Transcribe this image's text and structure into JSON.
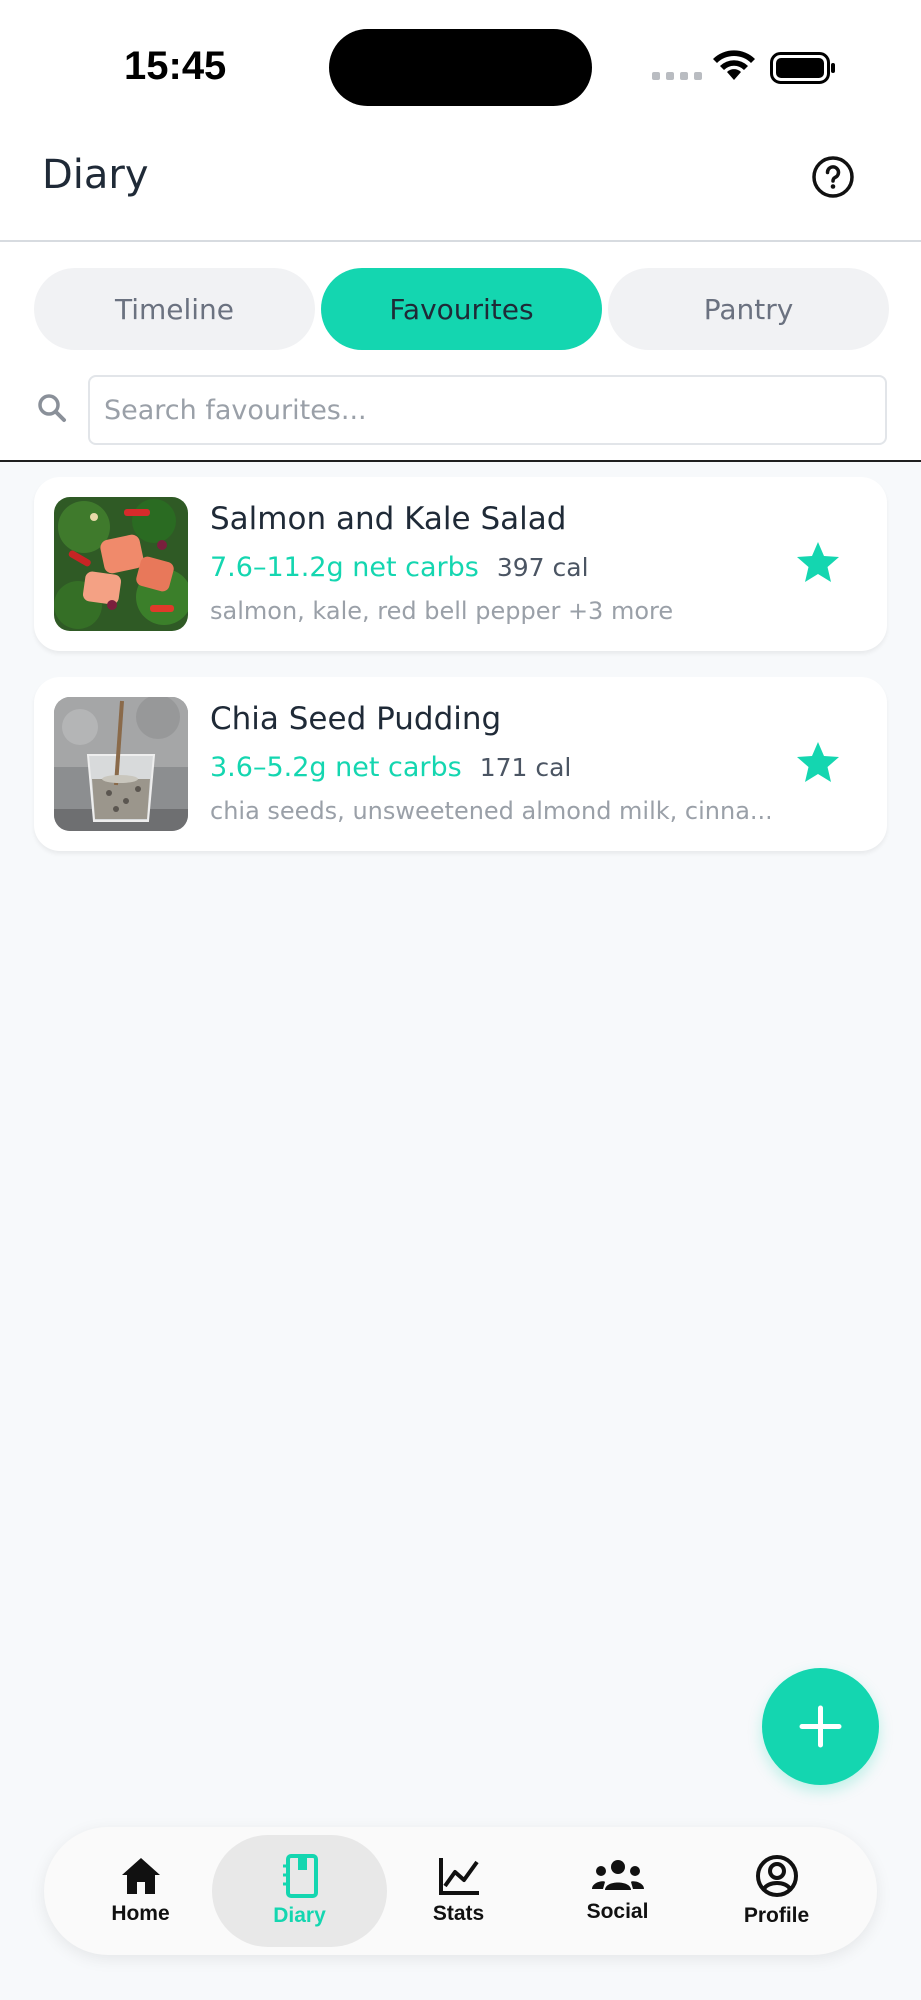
{
  "status_bar": {
    "time": "15:45"
  },
  "header": {
    "title": "Diary",
    "help_icon": "help-circle-icon"
  },
  "tabs": [
    {
      "label": "Timeline",
      "active": false
    },
    {
      "label": "Favourites",
      "active": true
    },
    {
      "label": "Pantry",
      "active": false
    }
  ],
  "search": {
    "placeholder": "Search favourites...",
    "value": ""
  },
  "favourites": [
    {
      "title": "Salmon and Kale Salad",
      "carbs": "7.6–11.2g net carbs",
      "calories": "397 cal",
      "ingredients": "salmon, kale, red bell pepper +3 more",
      "favourite_icon": "star-icon"
    },
    {
      "title": "Chia Seed Pudding",
      "carbs": "3.6–5.2g net carbs",
      "calories": "171 cal",
      "ingredients": "chia seeds, unsweetened almond milk, cinna...",
      "favourite_icon": "star-icon"
    }
  ],
  "fab": {
    "icon": "plus-icon"
  },
  "bottom_nav": [
    {
      "label": "Home",
      "icon": "home-icon",
      "active": false
    },
    {
      "label": "Diary",
      "icon": "diary-icon",
      "active": true
    },
    {
      "label": "Stats",
      "icon": "chart-icon",
      "active": false
    },
    {
      "label": "Social",
      "icon": "people-icon",
      "active": false
    },
    {
      "label": "Profile",
      "icon": "profile-icon",
      "active": false
    }
  ],
  "colors": {
    "accent": "#14d6b0",
    "background": "#f7f9fb",
    "text_primary": "#1f2a37",
    "text_muted": "#9aa0a8"
  }
}
